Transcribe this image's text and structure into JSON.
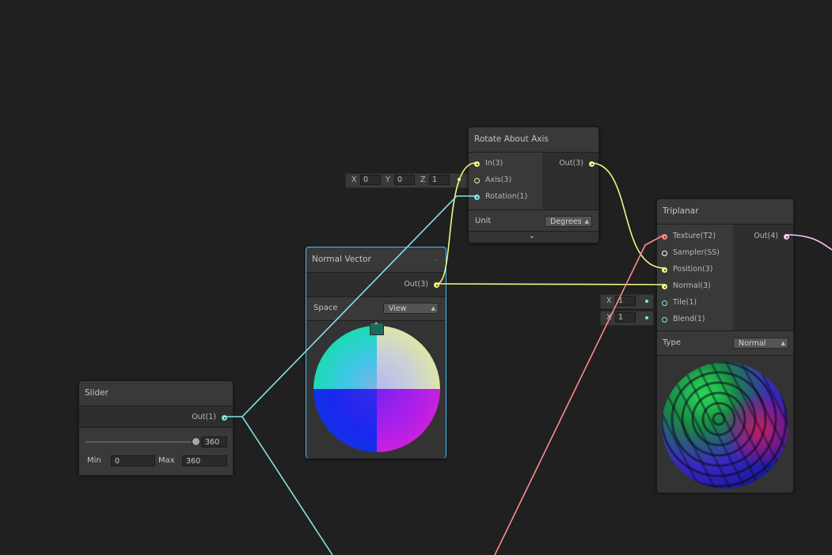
{
  "colors": {
    "canvas": "#202020",
    "node_body": "#393939",
    "port_area": "#2e2e2e",
    "selected_border": "#44c0ff",
    "vector3_port": "#f4f585",
    "vector1_port": "#84e4e7",
    "texture_port": "#ff8b8b",
    "vector4_port": "#fbcbf4",
    "sampler_port": "#ffffff"
  },
  "rotate_node": {
    "title": "Rotate About Axis",
    "inputs": [
      "In(3)",
      "Axis(3)",
      "Rotation(1)"
    ],
    "output": "Out(3)",
    "unit_label": "Unit",
    "unit_value": "Degrees"
  },
  "axis_inline": {
    "x_label": "X",
    "x_value": "0",
    "y_label": "Y",
    "y_value": "0",
    "z_label": "Z",
    "z_value": "1"
  },
  "normal_node": {
    "title": "Normal Vector",
    "output": "Out(3)",
    "space_label": "Space",
    "space_value": "View"
  },
  "slider_node": {
    "title": "Slider",
    "output": "Out(1)",
    "slider_value": 360,
    "value_text": "360",
    "min_label": "Min",
    "min_value": "0",
    "max_label": "Max",
    "max_value": "360"
  },
  "triplanar_node": {
    "title": "Triplanar",
    "inputs": [
      "Texture(T2)",
      "Sampler(SS)",
      "Position(3)",
      "Normal(3)",
      "Tile(1)",
      "Blend(1)"
    ],
    "output": "Out(4)",
    "type_label": "Type",
    "type_value": "Normal"
  },
  "tile_inline": {
    "x_label": "X",
    "x_value": "1"
  },
  "blend_inline": {
    "x_label": "X",
    "x_value": "1"
  },
  "icons": {
    "collapse": "chevron-down-icon",
    "expand": "chevron-up-icon",
    "dropdown": "updown-arrows-icon"
  }
}
